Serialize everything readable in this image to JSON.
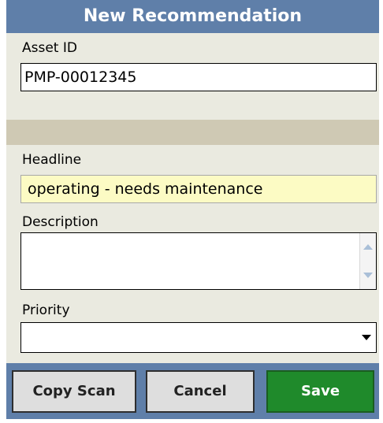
{
  "title": "New Recommendation",
  "asset": {
    "label": "Asset ID",
    "value": "PMP-00012345"
  },
  "headline": {
    "label": "Headline",
    "value": "operating - needs maintenance"
  },
  "description": {
    "label": "Description",
    "value": ""
  },
  "priority": {
    "label": "Priority",
    "value": ""
  },
  "buttons": {
    "copy_scan": "Copy Scan",
    "cancel": "Cancel",
    "save": "Save"
  },
  "colors": {
    "titlebar": "#5f7fa9",
    "save": "#1f8a2b",
    "headline_bg": "#fcfbc4"
  }
}
